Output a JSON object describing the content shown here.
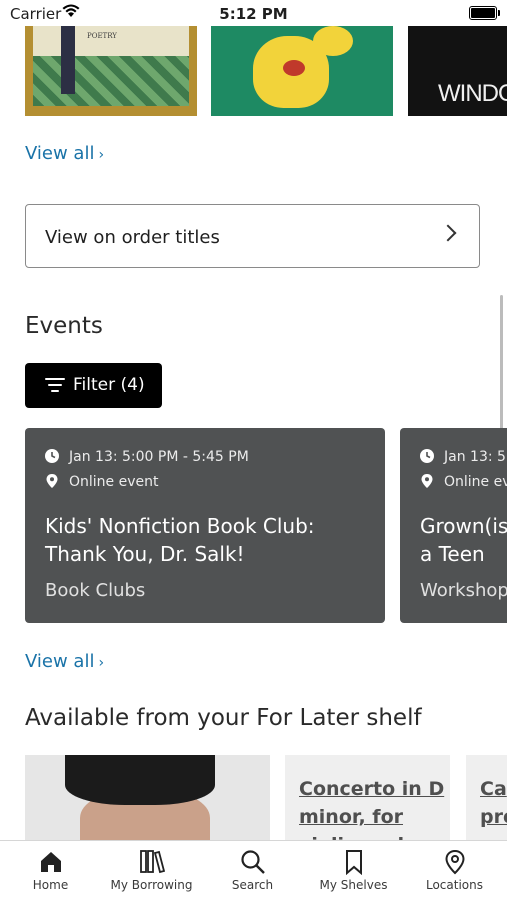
{
  "status_bar": {
    "carrier": "Carrier",
    "time": "5:12 PM"
  },
  "top_carousel": {
    "covers": [
      {
        "text": "POETRY"
      },
      {
        "text": ""
      },
      {
        "text": "WINDO"
      }
    ],
    "view_all": "View all"
  },
  "order_titles": {
    "label": "View on order titles"
  },
  "events": {
    "title": "Events",
    "filter_label": "Filter (4)",
    "cards": [
      {
        "time": "Jan 13: 5:00 PM - 5:45 PM",
        "location": "Online event",
        "title": "Kids' Nonfiction Book Club: Thank You, Dr. Salk!",
        "category": "Book Clubs"
      },
      {
        "time": "Jan 13: 5",
        "location": "Online ev",
        "title": "Grown(is a Teen",
        "category": "Workshop"
      }
    ],
    "view_all": "View all"
  },
  "for_later": {
    "title": "Available from your For Later shelf",
    "items": [
      {
        "text": ""
      },
      {
        "text": "Concerto in D minor, for violin and"
      },
      {
        "text": "Ca pro f"
      }
    ]
  },
  "tabbar": {
    "tabs": [
      {
        "label": "Home",
        "icon": "home-icon"
      },
      {
        "label": "My Borrowing",
        "icon": "books-icon"
      },
      {
        "label": "Search",
        "icon": "search-icon"
      },
      {
        "label": "My Shelves",
        "icon": "bookmark-icon"
      },
      {
        "label": "Locations",
        "icon": "location-pin-icon"
      }
    ]
  },
  "colors": {
    "link": "#1a73a8",
    "event_card": "#505253",
    "filter_bg": "#000000"
  }
}
